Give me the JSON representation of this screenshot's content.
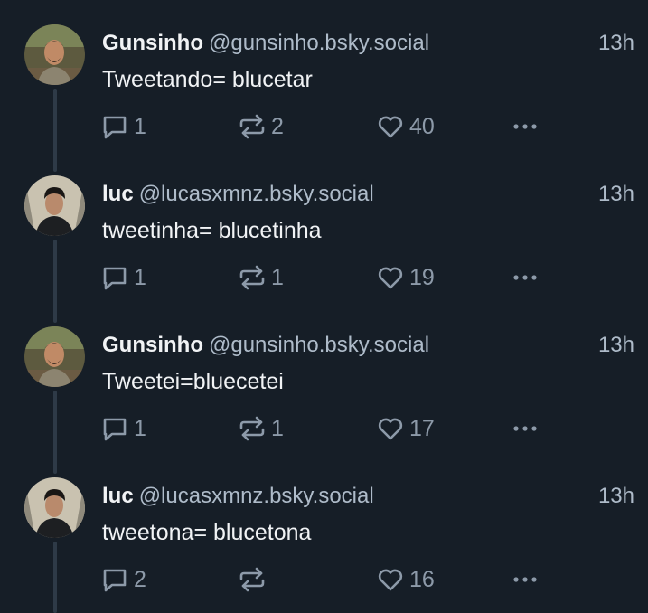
{
  "posts": [
    {
      "display_name": "Gunsinho",
      "handle": "@gunsinho.bsky.social",
      "time": "13h",
      "text": "Tweetando= blucetar",
      "replies": "1",
      "reposts": "2",
      "likes": "40"
    },
    {
      "display_name": "luc",
      "handle": "@lucasxmnz.bsky.social",
      "time": "13h",
      "text": "tweetinha= blucetinha",
      "replies": "1",
      "reposts": "1",
      "likes": "19"
    },
    {
      "display_name": "Gunsinho",
      "handle": "@gunsinho.bsky.social",
      "time": "13h",
      "text": "Tweetei=bluecetei",
      "replies": "1",
      "reposts": "1",
      "likes": "17"
    },
    {
      "display_name": "luc",
      "handle": "@lucasxmnz.bsky.social",
      "time": "13h",
      "text": "tweetona= blucetona",
      "replies": "2",
      "reposts": "",
      "likes": "16"
    }
  ],
  "colors": {
    "background": "#161e27",
    "primary_text": "#f1f3f5",
    "secondary_text": "#aebbc9",
    "icon": "#8d9aa9",
    "thread_line": "#2e3a47"
  },
  "icons": {
    "reply": "speech-bubble-icon",
    "repost": "repost-arrows-icon",
    "like": "heart-icon",
    "more": "ellipsis-icon"
  }
}
